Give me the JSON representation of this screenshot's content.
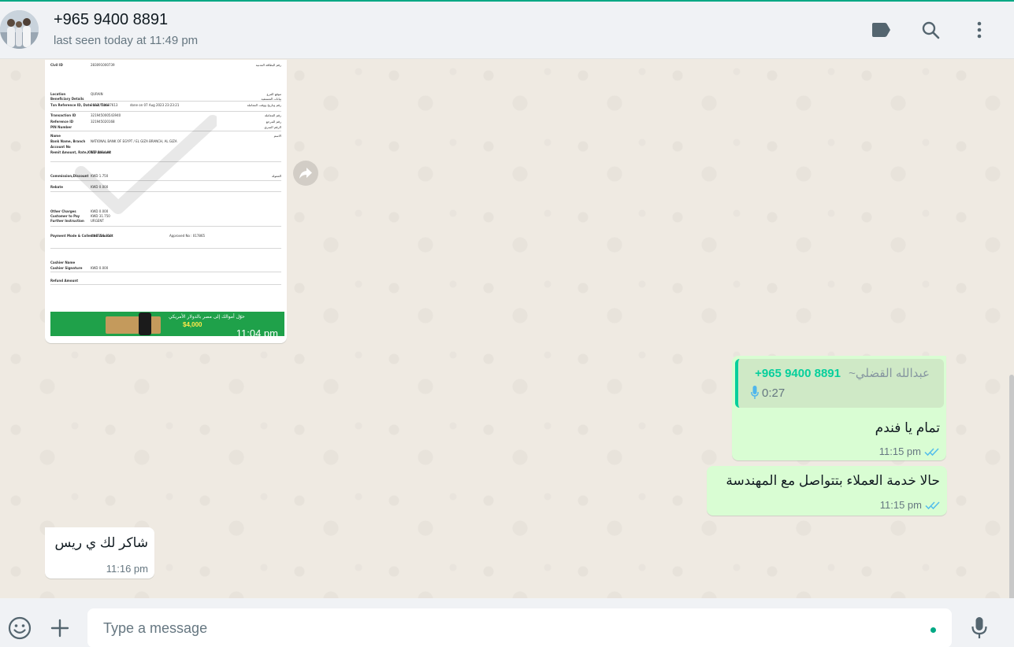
{
  "header": {
    "contact_number": "+965 9400 8891",
    "status": "last seen today at 11:49 pm"
  },
  "icons": {
    "label": "label-icon",
    "search": "search-icon",
    "menu": "more-vertical-icon",
    "emoji": "emoji-icon",
    "attach": "plus-icon",
    "mic": "mic-icon",
    "forward": "forward-icon",
    "ticks": "double-check-icon"
  },
  "colors": {
    "accent": "#00a884",
    "outgoing_bubble": "#d9fdd3",
    "incoming_bubble": "#ffffff",
    "tick_read": "#53bdeb"
  },
  "messages": [
    {
      "type": "image",
      "direction": "incoming",
      "time": "11:04 pm",
      "receipt": {
        "civil_id_label": "Civil ID",
        "civil_id": "283091000739",
        "location_label": "Location",
        "location": "QURAIN",
        "beneficiary_label": "Beneficiary Details",
        "txn_label": "Txn Reference ID, Date and Time",
        "txn_value": "2023 / 10637613",
        "txn_date": "done on 07 Aug 2023 23:23:21",
        "transaction_label": "Transaction ID",
        "transaction_id": "321945000543940",
        "reference_label": "Reference ID",
        "reference_id": "321945020168",
        "pin_label": "PIN Number",
        "name_label": "Name",
        "bank_label": "Bank Name, Branch",
        "bank": "NATIONAL BANK OF EGYPT  /  EL GIZA BRANCH, AL GIZA",
        "account_label": "Account No",
        "account_value": "EGP 3014.00",
        "remit_label": "Remit Amount, Rate,KWD Amount",
        "commission_label": "Commission,Discount",
        "commission": "KWD  1.750",
        "rebate_label": "Rebate",
        "rebate": "KWD  0.000",
        "other_label": "Other Charges",
        "other": "KWD  0.000",
        "customer_pay_label": "Customer to Pay",
        "customer_pay": "KWD  31.750",
        "further_label": "Further Instruction",
        "further": "URGENT",
        "payment_label": "Payment Mode & Collected Amount",
        "payment": "K-NET   31.750",
        "approved": "Approved No : 017865",
        "cashier_label": "Cashier Name",
        "cashier_sig_label": "Cashier Signature",
        "cashier_sig": "KWD  0.000",
        "refund_label": "Refund Amount",
        "banner_text": "حوّل أموالك إلى مصر بالدولار الأمريكي",
        "banner_prize": "$4,000"
      }
    },
    {
      "type": "text",
      "direction": "outgoing",
      "quote_author": "+965 9400 8891",
      "quote_name": "~عبدالله القضلي",
      "quote_duration": "0:27",
      "text": "تمام يا فندم",
      "time": "11:15 pm"
    },
    {
      "type": "text",
      "direction": "outgoing",
      "text": "حالا خدمة العملاء بتتواصل مع المهندسة",
      "time": "11:15 pm"
    },
    {
      "type": "text",
      "direction": "incoming",
      "text": "شاكر لك ي ريس",
      "time": "11:16 pm"
    }
  ],
  "composer": {
    "placeholder": "Type a message"
  }
}
